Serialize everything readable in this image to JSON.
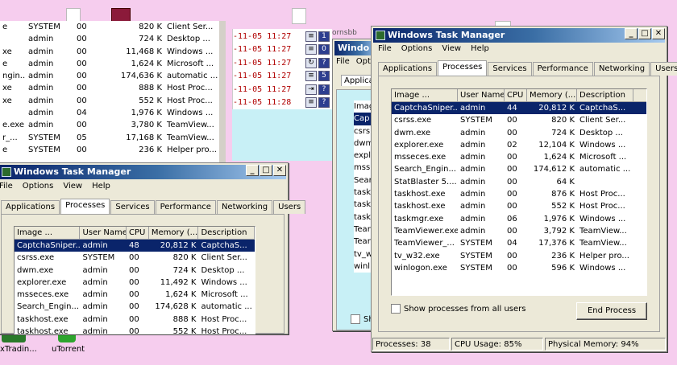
{
  "desktop": {
    "icons": [
      {
        "label": "xTradin..."
      },
      {
        "label": "uTorrent"
      }
    ],
    "log_rows": [
      {
        "time": "-11-05 11:27",
        "a": "≡",
        "b": "1"
      },
      {
        "time": "-11-05 11:27",
        "a": "≡",
        "b": "0"
      },
      {
        "time": "-11-05 11:27",
        "a": "↻",
        "b": "?"
      },
      {
        "time": "-11-05 11:27",
        "a": "≡",
        "b": "5"
      },
      {
        "time": "-11-05 11:27",
        "a": "⇥",
        "b": "?"
      },
      {
        "time": "-11-05 11:28",
        "a": "≡",
        "b": "?"
      }
    ],
    "partial_window": {
      "title": "Windo",
      "menu": [
        "File",
        "Opt"
      ],
      "tab": "Applica",
      "items": [
        "Imag",
        "Cap",
        "csrs",
        "dwm",
        "expl",
        "mss",
        "Sear",
        "task",
        "task",
        "task",
        "Tear",
        "Tear",
        "tv_w",
        "winl"
      ],
      "checkbox": "Sh"
    },
    "bg_list": {
      "rows": [
        [
          "SYSTEM",
          "00",
          "820 K",
          "Client Ser..."
        ],
        [
          "admin",
          "00",
          "724 K",
          "Desktop ..."
        ],
        [
          "admin",
          "00",
          "11,468 K",
          "Windows ..."
        ],
        [
          "admin",
          "00",
          "1,624 K",
          "Microsoft ..."
        ],
        [
          "admin",
          "00",
          "174,636 K",
          "automatic ..."
        ],
        [
          "admin",
          "00",
          "888 K",
          "Host Proc..."
        ],
        [
          "admin",
          "00",
          "552 K",
          "Host Proc..."
        ],
        [
          "admin",
          "04",
          "1,976 K",
          "Windows ..."
        ],
        [
          "admin",
          "00",
          "3,780 K",
          "TeamView..."
        ],
        [
          "SYSTEM",
          "05",
          "17,168 K",
          "TeamView..."
        ],
        [
          "SYSTEM",
          "00",
          "236 K",
          "Helper pro..."
        ]
      ],
      "left_cut": [
        "e",
        "",
        "xe",
        "e",
        "ngin...",
        "xe",
        "xe",
        "",
        "e.exe",
        "r_...",
        "e"
      ]
    }
  },
  "tm_front": {
    "title": "Windows Task Manager",
    "menu": [
      "File",
      "Options",
      "View",
      "Help"
    ],
    "tabs": [
      "Applications",
      "Processes",
      "Services",
      "Performance",
      "Networking",
      "Users"
    ],
    "active_tab": "Processes",
    "columns": [
      "Image ...",
      "User Name",
      "CPU",
      "Memory (...",
      "Description"
    ],
    "rows": [
      [
        "CaptchaSniper...",
        "admin",
        "44",
        "20,812 K",
        "CaptchaS..."
      ],
      [
        "csrss.exe",
        "SYSTEM",
        "00",
        "820 K",
        "Client Ser..."
      ],
      [
        "dwm.exe",
        "admin",
        "00",
        "724 K",
        "Desktop ..."
      ],
      [
        "explorer.exe",
        "admin",
        "02",
        "12,104 K",
        "Windows ..."
      ],
      [
        "msseces.exe",
        "admin",
        "00",
        "1,624 K",
        "Microsoft ..."
      ],
      [
        "Search_Engin...",
        "admin",
        "00",
        "174,612 K",
        "automatic ..."
      ],
      [
        "StatBlaster 5....",
        "admin",
        "00",
        "64 K",
        ""
      ],
      [
        "taskhost.exe",
        "admin",
        "00",
        "876 K",
        "Host Proc..."
      ],
      [
        "taskhost.exe",
        "admin",
        "00",
        "552 K",
        "Host Proc..."
      ],
      [
        "taskmgr.exe",
        "admin",
        "06",
        "1,976 K",
        "Windows ..."
      ],
      [
        "TeamViewer.exe",
        "admin",
        "00",
        "3,792 K",
        "TeamView..."
      ],
      [
        "TeamViewer_...",
        "SYSTEM",
        "04",
        "17,376 K",
        "TeamView..."
      ],
      [
        "tv_w32.exe",
        "SYSTEM",
        "00",
        "236 K",
        "Helper pro..."
      ],
      [
        "winlogon.exe",
        "SYSTEM",
        "00",
        "596 K",
        "Windows ..."
      ]
    ],
    "show_all": "Show processes from all users",
    "end_process": "End Process",
    "status": {
      "processes": "Processes: 38",
      "cpu": "CPU Usage: 85%",
      "memory": "Physical Memory: 94%"
    }
  },
  "tm_back": {
    "title": "Windows Task Manager",
    "menu": [
      "File",
      "Options",
      "View",
      "Help"
    ],
    "tabs": [
      "Applications",
      "Processes",
      "Services",
      "Performance",
      "Networking",
      "Users"
    ],
    "columns": [
      "Image ...",
      "User Name",
      "CPU",
      "Memory (...",
      "Description"
    ],
    "rows": [
      [
        "CaptchaSniper...",
        "admin",
        "48",
        "20,812 K",
        "CaptchaS..."
      ],
      [
        "csrss.exe",
        "SYSTEM",
        "00",
        "820 K",
        "Client Ser..."
      ],
      [
        "dwm.exe",
        "admin",
        "00",
        "724 K",
        "Desktop ..."
      ],
      [
        "explorer.exe",
        "admin",
        "00",
        "11,492 K",
        "Windows ..."
      ],
      [
        "msseces.exe",
        "admin",
        "00",
        "1,624 K",
        "Microsoft ..."
      ],
      [
        "Search_Engin...",
        "admin",
        "00",
        "174,628 K",
        "automatic ..."
      ],
      [
        "taskhost.exe",
        "admin",
        "00",
        "888 K",
        "Host Proc..."
      ],
      [
        "taskhost.exe",
        "admin",
        "00",
        "552 K",
        "Host Proc..."
      ]
    ]
  }
}
